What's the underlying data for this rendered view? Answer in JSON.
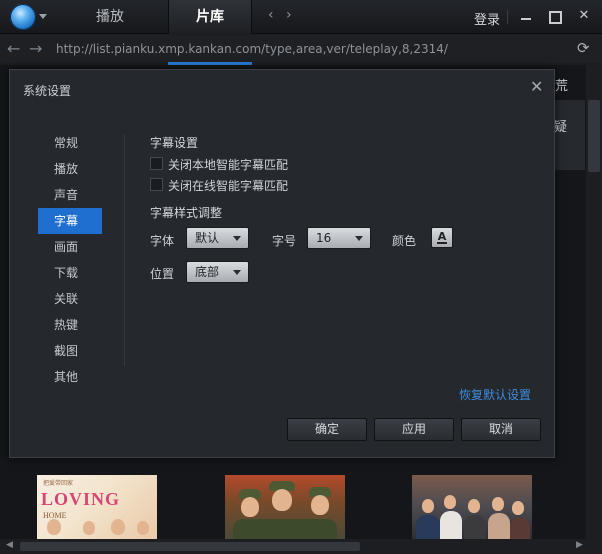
{
  "titlebar": {
    "tabs": [
      {
        "label": "播放"
      },
      {
        "label": "片库"
      }
    ],
    "nav_prev": "‹",
    "nav_next": "›",
    "login_label": "登录"
  },
  "address": {
    "url": "http://list.pianku.xmp.kankan.com/type,area,ver/teleplay,8,2314/"
  },
  "background": {
    "partial_chars": [
      "荒",
      "疑"
    ],
    "posters": [
      {
        "title": "LOVING",
        "subtitle": "HOME",
        "top_text": "把爱带回家"
      }
    ]
  },
  "dialog": {
    "title": "系统设置",
    "nav": [
      {
        "label": "常规"
      },
      {
        "label": "播放"
      },
      {
        "label": "声音"
      },
      {
        "label": "字幕"
      },
      {
        "label": "画面"
      },
      {
        "label": "下载"
      },
      {
        "label": "关联"
      },
      {
        "label": "热键"
      },
      {
        "label": "截图"
      },
      {
        "label": "其他"
      }
    ],
    "active_nav": "字幕",
    "subtitle_section": "字幕设置",
    "options": [
      {
        "label": "关闭本地智能字幕匹配",
        "checked": false
      },
      {
        "label": "关闭在线智能字幕匹配",
        "checked": false
      }
    ],
    "style_section": "字幕样式调整",
    "font_label": "字体",
    "font_value": "默认",
    "size_label": "字号",
    "size_value": "16",
    "color_label": "颜色",
    "color_icon": "A",
    "position_label": "位置",
    "position_value": "底部",
    "restore_link": "恢复默认设置",
    "buttons": {
      "ok": "确定",
      "apply": "应用",
      "cancel": "取消"
    },
    "accent_color": "#1f6fd0",
    "link_color": "#3d8ddc"
  }
}
